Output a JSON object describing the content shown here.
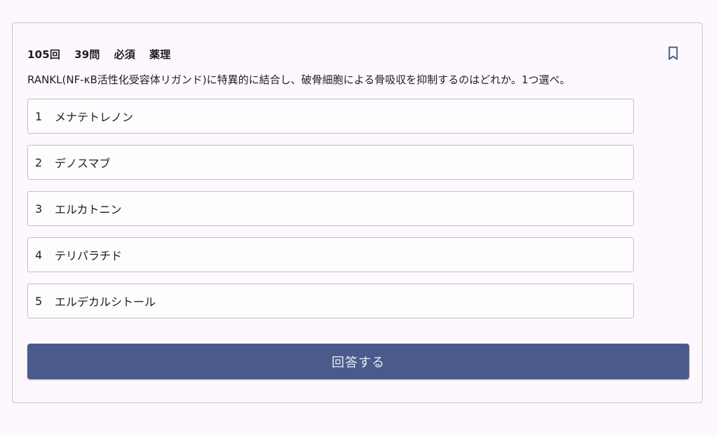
{
  "header": {
    "exam": "105回",
    "number": "39問",
    "category": "必須",
    "subject": "薬理",
    "bookmark_icon": "bookmark-outline-icon"
  },
  "question": "RANKL(NF-κB活性化受容体リガンド)に特異的に結合し、破骨細胞による骨吸収を抑制するのはどれか。1つ選べ。",
  "choices": [
    {
      "num": "1",
      "label": "メナテトレノン"
    },
    {
      "num": "2",
      "label": "デノスマブ"
    },
    {
      "num": "3",
      "label": "エルカトニン"
    },
    {
      "num": "4",
      "label": "テリパラチド"
    },
    {
      "num": "5",
      "label": "エルデカルシトール"
    }
  ],
  "submit_label": "回答する",
  "colors": {
    "background": "#fcf8fd",
    "button": "#4a5b8b",
    "border": "#c1c0c5"
  }
}
